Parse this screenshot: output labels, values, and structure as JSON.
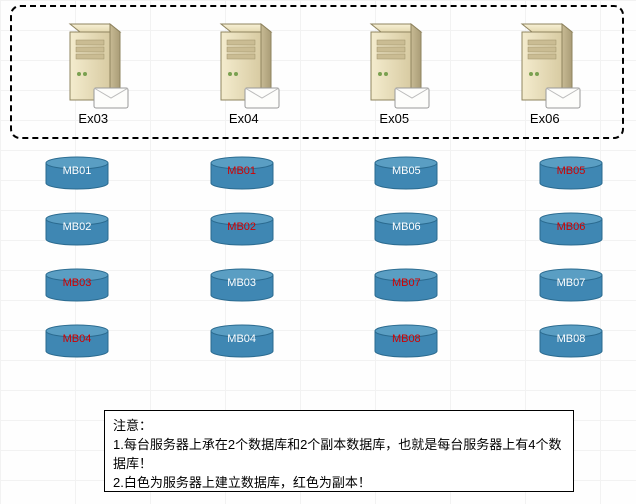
{
  "servers": [
    {
      "label": "Ex03"
    },
    {
      "label": "Ex04"
    },
    {
      "label": "Ex05"
    },
    {
      "label": "Ex06"
    }
  ],
  "db_columns": [
    [
      {
        "label": "MB01",
        "copy": false
      },
      {
        "label": "MB02",
        "copy": false
      },
      {
        "label": "MB03",
        "copy": true
      },
      {
        "label": "MB04",
        "copy": true
      }
    ],
    [
      {
        "label": "MB01",
        "copy": true
      },
      {
        "label": "MB02",
        "copy": true
      },
      {
        "label": "MB03",
        "copy": false
      },
      {
        "label": "MB04",
        "copy": false
      }
    ],
    [
      {
        "label": "MB05",
        "copy": false
      },
      {
        "label": "MB06",
        "copy": false
      },
      {
        "label": "MB07",
        "copy": true
      },
      {
        "label": "MB08",
        "copy": true
      }
    ],
    [
      {
        "label": "MB05",
        "copy": true
      },
      {
        "label": "MB06",
        "copy": true
      },
      {
        "label": "MB07",
        "copy": false
      },
      {
        "label": "MB08",
        "copy": false
      }
    ]
  ],
  "note": {
    "header": "注意：",
    "line1": "1.每台服务器上承在2个数据库和2个副本数据库，也就是每台服务器上有4个数据库！",
    "line2": "2.白色为服务器上建立数据库，红色为副本！"
  },
  "colors": {
    "db_body": "#3f87b3",
    "db_top": "#5a9ec3",
    "db_stroke": "#2a6a8f",
    "server_beige_light": "#f1e8c8",
    "server_beige_dark": "#d0c39a",
    "server_side": "#b7ab85"
  }
}
